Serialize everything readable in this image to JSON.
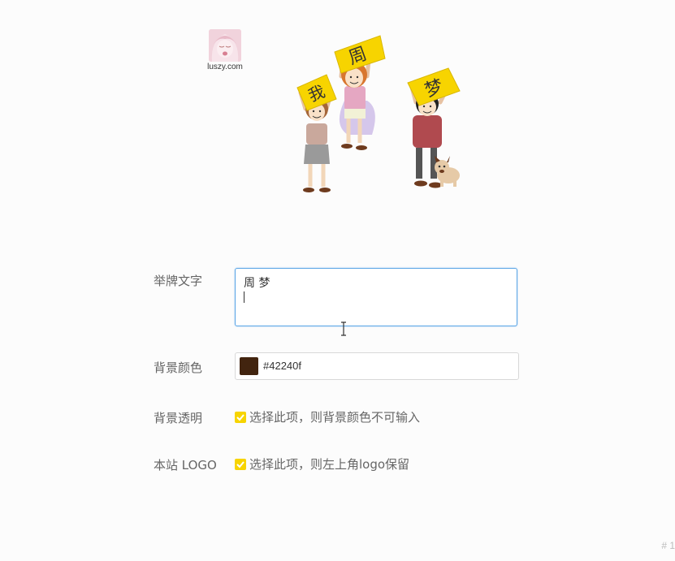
{
  "site": {
    "logo_text": "luszy.com"
  },
  "illustration": {
    "signs": [
      "我",
      "周",
      "梦"
    ]
  },
  "form": {
    "sign_text": {
      "label": "举牌文字",
      "value": "周 梦"
    },
    "bg_color": {
      "label": "背景颜色",
      "value": "#42240f",
      "swatch_color": "#42240f"
    },
    "bg_transparent": {
      "label": "背景透明",
      "option": "选择此项，则背景颜色不可输入",
      "checked": true
    },
    "site_logo": {
      "label": "本站 LOGO",
      "option": "选择此项，则左上角logo保留",
      "checked": true
    }
  },
  "corner_number": "# 1",
  "colors": {
    "accent": "#f7d400",
    "focus_border": "#5aa5e6"
  }
}
